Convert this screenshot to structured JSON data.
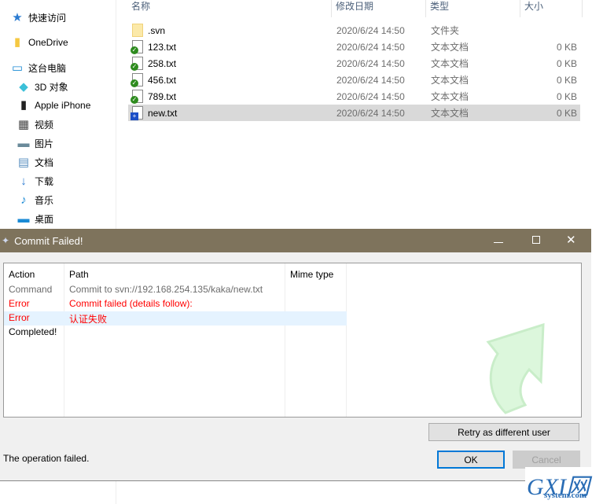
{
  "explorer": {
    "sidebar": [
      {
        "label": "快速访问",
        "icon": "star-icon"
      },
      {
        "label": "OneDrive",
        "icon": "folder-icon"
      },
      {
        "label": "这台电脑",
        "icon": "computer-icon"
      },
      {
        "label": "3D 对象",
        "icon": "cube-icon"
      },
      {
        "label": "Apple iPhone",
        "icon": "phone-icon"
      },
      {
        "label": "视频",
        "icon": "video-icon"
      },
      {
        "label": "图片",
        "icon": "picture-icon"
      },
      {
        "label": "文档",
        "icon": "document-icon"
      },
      {
        "label": "下载",
        "icon": "download-icon"
      },
      {
        "label": "音乐",
        "icon": "music-icon"
      },
      {
        "label": "桌面",
        "icon": "desktop-icon"
      }
    ],
    "columns": [
      "名称",
      "修改日期",
      "类型",
      "大小"
    ],
    "files": [
      {
        "name": ".svn",
        "date": "2020/6/24 14:50",
        "type": "文件夹",
        "size": "",
        "status": "folder"
      },
      {
        "name": "123.txt",
        "date": "2020/6/24 14:50",
        "type": "文本文档",
        "size": "0 KB",
        "status": "normal"
      },
      {
        "name": "258.txt",
        "date": "2020/6/24 14:50",
        "type": "文本文档",
        "size": "0 KB",
        "status": "normal"
      },
      {
        "name": "456.txt",
        "date": "2020/6/24 14:50",
        "type": "文本文档",
        "size": "0 KB",
        "status": "normal"
      },
      {
        "name": "789.txt",
        "date": "2020/6/24 14:50",
        "type": "文本文档",
        "size": "0 KB",
        "status": "normal"
      },
      {
        "name": "new.txt",
        "date": "2020/6/24 14:50",
        "type": "文本文档",
        "size": "0 KB",
        "status": "added",
        "selected": true
      }
    ]
  },
  "dialog": {
    "title": "Commit Failed!",
    "columns": [
      "Action",
      "Path",
      "Mime type"
    ],
    "rows": [
      {
        "action": "Command",
        "path": "Commit to svn://192.168.254.135/kaka/new.txt",
        "color": "#6d6d6d"
      },
      {
        "action": "Error",
        "path": "Commit failed (details follow):",
        "color": "#ff0000"
      },
      {
        "action": "Error",
        "path": "认证失败",
        "color": "#ff0000",
        "highlight": true
      },
      {
        "action": "Completed!",
        "path": "",
        "color": "#000000"
      }
    ],
    "retry_label": "Retry as different user",
    "status": "The operation failed.",
    "ok_label": "OK",
    "cancel_label": "Cancel"
  },
  "watermark": {
    "text": "GXI网",
    "sub": "system.com"
  },
  "colors": {
    "titlebar": "#7e735c",
    "error": "#ff0000",
    "highlight": "#e5f3ff",
    "selected": "#d9d9d9"
  }
}
